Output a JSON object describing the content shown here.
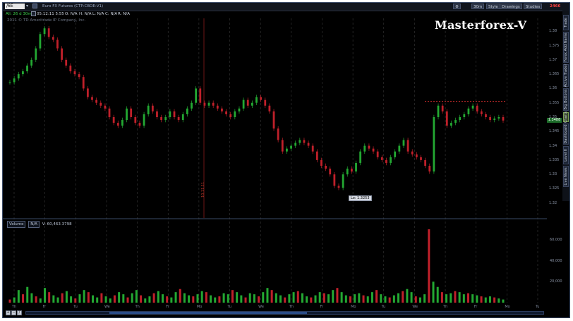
{
  "toolbar": {
    "symbol": "/6E",
    "description": "Euro FX Futures (CTP:CBOE:V1)",
    "buttons": {
      "timeframe": "30m",
      "style": "Style",
      "drawings": "Drawings",
      "studies": "Studies"
    },
    "flag_value": "2466"
  },
  "info_row": {
    "period": "All: 26 d 30m",
    "time": "05:12:11 5:55",
    "open": "O: N/A",
    "high": "H: N/A",
    "low": "L: N/A",
    "close": "C: N/A",
    "change": "R: N/A"
  },
  "copyright": "2011 © TD Ameritrade IP Company, Inc.",
  "watermark": "Masterforex-V",
  "side_tabs": [
    "Trade",
    "Forex Add Name",
    "Active Trader",
    "Big Buttons",
    "Charts",
    "Dashboard",
    "Level II",
    "Live News"
  ],
  "active_side_tab": "Charts",
  "price_axis": {
    "labels": [
      "1.38",
      "1.375",
      "1.37",
      "1.365",
      "1.36",
      "1.355",
      "1.35",
      "1.345",
      "1.34",
      "1.335",
      "1.33",
      "1.325",
      "1.32"
    ],
    "last_price": "1.3488"
  },
  "chart_data": {
    "type": "line",
    "title": "",
    "xlabel": "",
    "ylabel": "",
    "ylim": [
      1.316,
      1.384
    ],
    "low_label": "Lo: 1.3253",
    "date_marker": "10.11.11",
    "resistance_level": 1.3555,
    "series": [
      {
        "values": [
          1.3622,
          1.3635,
          1.365,
          1.366,
          1.368,
          1.37,
          1.374,
          1.379,
          1.381,
          1.378,
          1.377,
          1.374,
          1.37,
          1.368,
          1.366,
          1.365,
          1.364,
          1.36,
          1.357,
          1.356,
          1.355,
          1.354,
          1.353,
          1.35,
          1.348,
          1.347,
          1.349,
          1.353,
          1.35,
          1.348,
          1.347,
          1.351,
          1.354,
          1.352,
          1.35,
          1.349,
          1.35,
          1.352,
          1.35,
          1.349,
          1.351,
          1.353,
          1.355,
          1.36,
          1.355,
          1.354,
          1.355,
          1.354,
          1.353,
          1.352,
          1.351,
          1.35,
          1.352,
          1.353,
          1.356,
          1.354,
          1.355,
          1.357,
          1.356,
          1.354,
          1.352,
          1.346,
          1.342,
          1.338,
          1.339,
          1.34,
          1.341,
          1.342,
          1.341,
          1.34,
          1.338,
          1.335,
          1.333,
          1.332,
          1.33,
          1.326,
          1.3253,
          1.33,
          1.332,
          1.331,
          1.334,
          1.338,
          1.34,
          1.339,
          1.338,
          1.336,
          1.335,
          1.334,
          1.336,
          1.338,
          1.34,
          1.342,
          1.338,
          1.337,
          1.336,
          1.335,
          1.333,
          1.331,
          1.35,
          1.354,
          1.352,
          1.347,
          1.348,
          1.349,
          1.35,
          1.351,
          1.353,
          1.354,
          1.352,
          1.351,
          1.35,
          1.349,
          1.3495,
          1.35,
          1.3488
        ]
      }
    ],
    "volume": {
      "labels": [
        "60,000",
        "40,000",
        "20,000"
      ],
      "ylim": [
        0,
        72000
      ],
      "values": [
        3000,
        5000,
        12000,
        8000,
        15000,
        9000,
        6000,
        4000,
        14000,
        10000,
        7000,
        5000,
        9000,
        11000,
        6000,
        4000,
        8000,
        12000,
        10000,
        7000,
        5000,
        9000,
        6000,
        4000,
        7000,
        10000,
        8000,
        5000,
        9000,
        12000,
        7000,
        4000,
        6000,
        9000,
        11000,
        8000,
        6000,
        5000,
        10000,
        13000,
        9000,
        7000,
        6000,
        8000,
        11000,
        10000,
        7000,
        5000,
        6000,
        9000,
        8000,
        12000,
        10000,
        7000,
        5000,
        9000,
        8000,
        6000,
        10000,
        14000,
        12000,
        9000,
        7000,
        5000,
        8000,
        10000,
        11000,
        9000,
        6000,
        5000,
        7000,
        10000,
        9000,
        8000,
        12000,
        14000,
        10000,
        7000,
        6000,
        8000,
        9000,
        7000,
        6000,
        10000,
        12000,
        8000,
        6000,
        5000,
        7000,
        9000,
        11000,
        13000,
        10000,
        6000,
        5000,
        8000,
        70000,
        20000,
        15000,
        10000,
        8000,
        9000,
        11000,
        10000,
        8000,
        9000,
        8000,
        7000,
        6000,
        5000,
        6000,
        5000,
        4000,
        3000
      ]
    },
    "x_labels": [
      "Th",
      "Fr",
      "Tu",
      "We",
      "Th",
      "Fr",
      "Mo",
      "Tu",
      "We",
      "Th",
      "Fr",
      "Mo",
      "Tu",
      "We",
      "Th",
      "Fr",
      "Mo",
      "Tu"
    ]
  },
  "volume_panel": {
    "title": "Volume",
    "na": "N/A",
    "value": "V: 60,463.3798"
  },
  "colors": {
    "up": "#23a832",
    "down": "#c0202a",
    "resistance": "#e03030",
    "background": "#000000",
    "grid": "#3a3a3a"
  }
}
